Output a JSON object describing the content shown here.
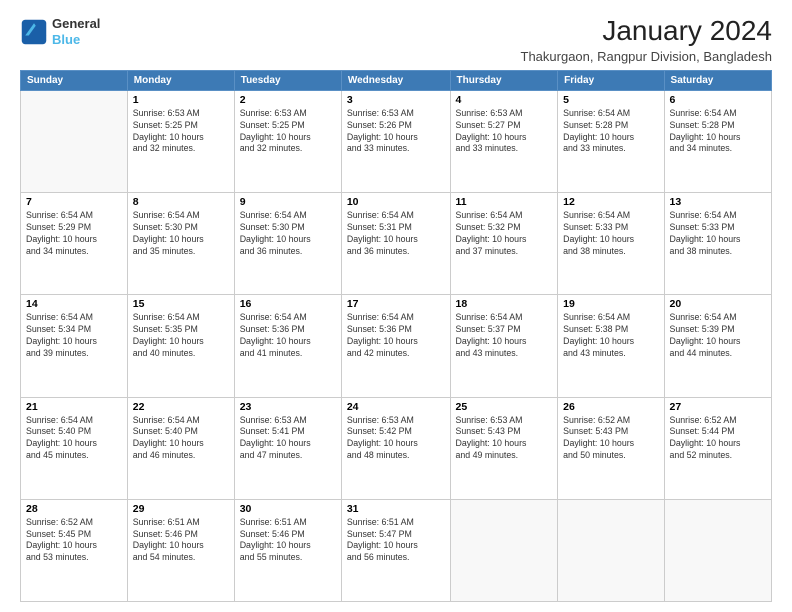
{
  "logo": {
    "line1": "General",
    "line2": "Blue"
  },
  "title": "January 2024",
  "location": "Thakurgaon, Rangpur Division, Bangladesh",
  "weekdays": [
    "Sunday",
    "Monday",
    "Tuesday",
    "Wednesday",
    "Thursday",
    "Friday",
    "Saturday"
  ],
  "weeks": [
    [
      {
        "day": "",
        "info": ""
      },
      {
        "day": "1",
        "info": "Sunrise: 6:53 AM\nSunset: 5:25 PM\nDaylight: 10 hours\nand 32 minutes."
      },
      {
        "day": "2",
        "info": "Sunrise: 6:53 AM\nSunset: 5:25 PM\nDaylight: 10 hours\nand 32 minutes."
      },
      {
        "day": "3",
        "info": "Sunrise: 6:53 AM\nSunset: 5:26 PM\nDaylight: 10 hours\nand 33 minutes."
      },
      {
        "day": "4",
        "info": "Sunrise: 6:53 AM\nSunset: 5:27 PM\nDaylight: 10 hours\nand 33 minutes."
      },
      {
        "day": "5",
        "info": "Sunrise: 6:54 AM\nSunset: 5:28 PM\nDaylight: 10 hours\nand 33 minutes."
      },
      {
        "day": "6",
        "info": "Sunrise: 6:54 AM\nSunset: 5:28 PM\nDaylight: 10 hours\nand 34 minutes."
      }
    ],
    [
      {
        "day": "7",
        "info": "Sunrise: 6:54 AM\nSunset: 5:29 PM\nDaylight: 10 hours\nand 34 minutes."
      },
      {
        "day": "8",
        "info": "Sunrise: 6:54 AM\nSunset: 5:30 PM\nDaylight: 10 hours\nand 35 minutes."
      },
      {
        "day": "9",
        "info": "Sunrise: 6:54 AM\nSunset: 5:30 PM\nDaylight: 10 hours\nand 36 minutes."
      },
      {
        "day": "10",
        "info": "Sunrise: 6:54 AM\nSunset: 5:31 PM\nDaylight: 10 hours\nand 36 minutes."
      },
      {
        "day": "11",
        "info": "Sunrise: 6:54 AM\nSunset: 5:32 PM\nDaylight: 10 hours\nand 37 minutes."
      },
      {
        "day": "12",
        "info": "Sunrise: 6:54 AM\nSunset: 5:33 PM\nDaylight: 10 hours\nand 38 minutes."
      },
      {
        "day": "13",
        "info": "Sunrise: 6:54 AM\nSunset: 5:33 PM\nDaylight: 10 hours\nand 38 minutes."
      }
    ],
    [
      {
        "day": "14",
        "info": "Sunrise: 6:54 AM\nSunset: 5:34 PM\nDaylight: 10 hours\nand 39 minutes."
      },
      {
        "day": "15",
        "info": "Sunrise: 6:54 AM\nSunset: 5:35 PM\nDaylight: 10 hours\nand 40 minutes."
      },
      {
        "day": "16",
        "info": "Sunrise: 6:54 AM\nSunset: 5:36 PM\nDaylight: 10 hours\nand 41 minutes."
      },
      {
        "day": "17",
        "info": "Sunrise: 6:54 AM\nSunset: 5:36 PM\nDaylight: 10 hours\nand 42 minutes."
      },
      {
        "day": "18",
        "info": "Sunrise: 6:54 AM\nSunset: 5:37 PM\nDaylight: 10 hours\nand 43 minutes."
      },
      {
        "day": "19",
        "info": "Sunrise: 6:54 AM\nSunset: 5:38 PM\nDaylight: 10 hours\nand 43 minutes."
      },
      {
        "day": "20",
        "info": "Sunrise: 6:54 AM\nSunset: 5:39 PM\nDaylight: 10 hours\nand 44 minutes."
      }
    ],
    [
      {
        "day": "21",
        "info": "Sunrise: 6:54 AM\nSunset: 5:40 PM\nDaylight: 10 hours\nand 45 minutes."
      },
      {
        "day": "22",
        "info": "Sunrise: 6:54 AM\nSunset: 5:40 PM\nDaylight: 10 hours\nand 46 minutes."
      },
      {
        "day": "23",
        "info": "Sunrise: 6:53 AM\nSunset: 5:41 PM\nDaylight: 10 hours\nand 47 minutes."
      },
      {
        "day": "24",
        "info": "Sunrise: 6:53 AM\nSunset: 5:42 PM\nDaylight: 10 hours\nand 48 minutes."
      },
      {
        "day": "25",
        "info": "Sunrise: 6:53 AM\nSunset: 5:43 PM\nDaylight: 10 hours\nand 49 minutes."
      },
      {
        "day": "26",
        "info": "Sunrise: 6:52 AM\nSunset: 5:43 PM\nDaylight: 10 hours\nand 50 minutes."
      },
      {
        "day": "27",
        "info": "Sunrise: 6:52 AM\nSunset: 5:44 PM\nDaylight: 10 hours\nand 52 minutes."
      }
    ],
    [
      {
        "day": "28",
        "info": "Sunrise: 6:52 AM\nSunset: 5:45 PM\nDaylight: 10 hours\nand 53 minutes."
      },
      {
        "day": "29",
        "info": "Sunrise: 6:51 AM\nSunset: 5:46 PM\nDaylight: 10 hours\nand 54 minutes."
      },
      {
        "day": "30",
        "info": "Sunrise: 6:51 AM\nSunset: 5:46 PM\nDaylight: 10 hours\nand 55 minutes."
      },
      {
        "day": "31",
        "info": "Sunrise: 6:51 AM\nSunset: 5:47 PM\nDaylight: 10 hours\nand 56 minutes."
      },
      {
        "day": "",
        "info": ""
      },
      {
        "day": "",
        "info": ""
      },
      {
        "day": "",
        "info": ""
      }
    ]
  ]
}
